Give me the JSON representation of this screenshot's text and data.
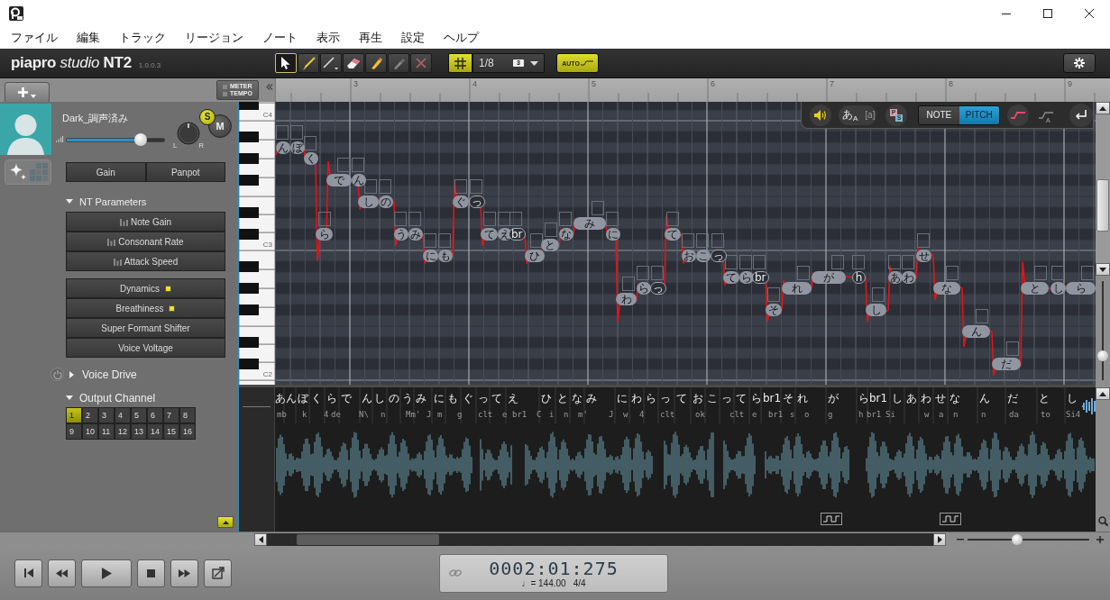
{
  "menu": [
    "ファイル",
    "編集",
    "トラック",
    "リージョン",
    "ノート",
    "表示",
    "再生",
    "設定",
    "ヘルプ"
  ],
  "toolbar": {
    "logo": "**piapro** *studio* **NT2**",
    "version": "1.0.0.3",
    "tools": [
      {
        "kind": "pointer",
        "selected": true
      },
      {
        "kind": "pencil",
        "selected": false
      },
      {
        "kind": "line",
        "selected": false
      },
      {
        "kind": "eraser",
        "selected": false
      },
      {
        "kind": "marker",
        "selected": false
      },
      {
        "kind": "pen",
        "selected": false
      },
      {
        "kind": "delete",
        "selected": false
      }
    ],
    "snap": {
      "grid_on": true,
      "value": "1/8",
      "triplet": "3"
    },
    "auto_button": "AUTO"
  },
  "track_header": {
    "meter_tempo": [
      "METER",
      "TEMPO"
    ]
  },
  "ruler": {
    "bars": [
      "3",
      "4",
      "5",
      "6",
      "7",
      "8",
      "9"
    ]
  },
  "track": {
    "name": "Dark_調声済み",
    "volume": {
      "level": 0.75
    },
    "pan_labels": [
      "L",
      "R"
    ],
    "solo": {
      "label": "S",
      "on": true
    },
    "mute": {
      "label": "M",
      "on": false
    },
    "view_modes": [
      {
        "kind": "sparkle",
        "selected": true
      },
      {
        "kind": "grid",
        "selected": false
      }
    ],
    "buttons": [
      "Gain",
      "Panpot"
    ],
    "nt_parameters": {
      "label": "NT Parameters",
      "expanded": true,
      "items": [
        "Note Gain",
        "Consonant Rate",
        "Attack Speed"
      ]
    },
    "effects": [
      {
        "label": "Dynamics",
        "edited": true
      },
      {
        "label": "Breathiness",
        "edited": true
      },
      {
        "label": "Super Formant Shifter",
        "edited": false
      },
      {
        "label": "Voice Voltage",
        "edited": false
      }
    ],
    "voice_drive": {
      "label": "Voice Drive",
      "expanded": false,
      "on": false
    },
    "output_channel": {
      "label": "Output Channel",
      "expanded": true,
      "channels": [
        {
          "label": "1",
          "selected": true
        },
        {
          "label": "2",
          "selected": false
        },
        {
          "label": "3",
          "selected": false
        },
        {
          "label": "4",
          "selected": false
        },
        {
          "label": "5",
          "selected": false
        },
        {
          "label": "6",
          "selected": false
        },
        {
          "label": "7",
          "selected": false
        },
        {
          "label": "8",
          "selected": false
        },
        {
          "label": "9",
          "selected": false
        },
        {
          "label": "10",
          "selected": false
        },
        {
          "label": "11",
          "selected": false
        },
        {
          "label": "12",
          "selected": false
        },
        {
          "label": "13",
          "selected": false
        },
        {
          "label": "14",
          "selected": false
        },
        {
          "label": "15",
          "selected": false
        },
        {
          "label": "16",
          "selected": false
        }
      ]
    }
  },
  "piano_roll": {
    "key_labels": [
      "C4",
      "C3",
      "C2"
    ],
    "overlay": {
      "speaker_on": true,
      "lyric_modes": [
        {
          "label": "あ$_{A}$",
          "selected": true
        },
        {
          "label": "[a]",
          "selected": false
        }
      ],
      "ps_labels": [
        "P",
        "S"
      ],
      "modes": [
        {
          "label": "NOTE",
          "selected": false
        },
        {
          "label": "PITCH",
          "selected": true
        }
      ],
      "curves": [
        {
          "kind": "pitch",
          "on": true
        },
        {
          "kind": "auto",
          "on": false,
          "label": "A"
        }
      ]
    },
    "notes": [
      {
        "lyric": "ん",
        "kind": "sung"
      },
      {
        "lyric": "ぼ",
        "kind": "sung"
      },
      {
        "lyric": "く",
        "kind": "sung"
      },
      {
        "lyric": "ら",
        "kind": "sung"
      },
      {
        "lyric": "で",
        "kind": "sung"
      },
      {
        "lyric": "ん",
        "kind": "sung"
      },
      {
        "lyric": "し",
        "kind": "sung"
      },
      {
        "lyric": "の",
        "kind": "sung"
      },
      {
        "lyric": "う",
        "kind": "sung"
      },
      {
        "lyric": "み",
        "kind": "sung"
      },
      {
        "lyric": "に",
        "kind": "sung"
      },
      {
        "lyric": "も",
        "kind": "sung"
      },
      {
        "lyric": "ぐ",
        "kind": "sung"
      },
      {
        "lyric": "っ",
        "kind": "pause"
      },
      {
        "lyric": "て",
        "kind": "sung"
      },
      {
        "lyric": "え",
        "kind": "sung"
      },
      {
        "lyric": "br",
        "kind": "pause"
      },
      {
        "lyric": "ひ",
        "kind": "sung"
      },
      {
        "lyric": "と",
        "kind": "sung"
      },
      {
        "lyric": "な",
        "kind": "sung"
      },
      {
        "lyric": "み",
        "kind": "sung"
      },
      {
        "lyric": "に",
        "kind": "sung"
      },
      {
        "lyric": "わ",
        "kind": "sung"
      },
      {
        "lyric": "ら",
        "kind": "sung"
      },
      {
        "lyric": "っ",
        "kind": "pause"
      },
      {
        "lyric": "て",
        "kind": "sung"
      },
      {
        "lyric": "お",
        "kind": "sung"
      },
      {
        "lyric": "こ",
        "kind": "sung"
      },
      {
        "lyric": "っ",
        "kind": "pause"
      },
      {
        "lyric": "て",
        "kind": "sung"
      },
      {
        "lyric": "ら",
        "kind": "sung"
      },
      {
        "lyric": "br",
        "kind": "pause"
      },
      {
        "lyric": "そ",
        "kind": "sung"
      },
      {
        "lyric": "れ",
        "kind": "sung"
      },
      {
        "lyric": "が",
        "kind": "sung"
      },
      {
        "lyric": "h",
        "kind": "pause"
      },
      {
        "lyric": "し",
        "kind": "sung"
      },
      {
        "lyric": "あ",
        "kind": "sung"
      },
      {
        "lyric": "わ",
        "kind": "sung"
      },
      {
        "lyric": "せ",
        "kind": "sung"
      },
      {
        "lyric": "な",
        "kind": "sung"
      },
      {
        "lyric": "ん",
        "kind": "sung"
      },
      {
        "lyric": "だ",
        "kind": "sung"
      },
      {
        "lyric": "と",
        "kind": "sung"
      },
      {
        "lyric": "し",
        "kind": "sung"
      },
      {
        "lyric": "ら",
        "kind": "sung"
      }
    ]
  },
  "lower_pane": {
    "lyrics": [
      "あ",
      "ん",
      "ぼ",
      "く",
      "ら",
      "で",
      "ん",
      "し",
      "の",
      "う",
      "み",
      "に",
      "も",
      "ぐ",
      "っ",
      "て",
      "え",
      "ひ",
      "と",
      "な",
      "み",
      "に",
      "わ",
      "ら",
      "っ",
      "て",
      "お",
      "こ",
      "っ",
      "て",
      "ら",
      "br1",
      "そ",
      "れ",
      "が",
      "ら",
      "br1",
      "し",
      "あ",
      "わ",
      "せ",
      "な",
      "ん",
      "だ",
      "と",
      "し"
    ],
    "phonemes": [
      "mb",
      "k",
      "4",
      "de",
      "N\\",
      "n",
      "Mm'",
      "J",
      "m",
      "g",
      "clt",
      "e",
      "br1",
      "C",
      "i",
      "n",
      "m'",
      "J",
      "w",
      "4",
      "clt",
      "ok",
      "clt",
      "e",
      "br1",
      "s",
      "o",
      "g",
      "h",
      "br1",
      "Si",
      "w",
      "a",
      "n",
      "n",
      "da",
      "to",
      "Si4"
    ]
  },
  "navigation": {
    "vertical_zoom": {
      "level": 0.25
    },
    "horizontal_zoom": {
      "level": 0.41
    }
  },
  "transport": {
    "buttons": [
      {
        "kind": "start"
      },
      {
        "kind": "rewind"
      },
      {
        "kind": "play"
      },
      {
        "kind": "stop"
      },
      {
        "kind": "forward"
      },
      {
        "kind": "loop"
      }
    ],
    "time": "0002:01:275",
    "tempo": "♩= 144.00",
    "time_signature": "4/4"
  }
}
